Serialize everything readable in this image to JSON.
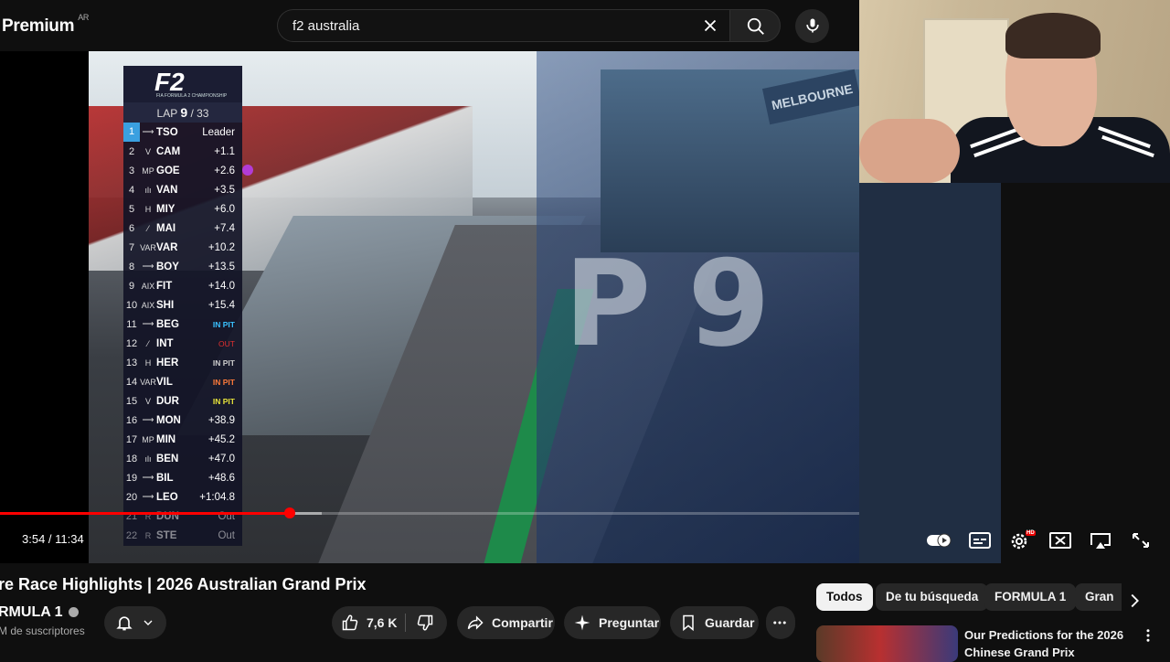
{
  "header": {
    "logo_text": "Premium",
    "logo_region": "AR",
    "search_value": "f2 australia"
  },
  "overlay": {
    "series": "F2",
    "series_sub": "FIA FORMULA 2 CHAMPIONSHIP",
    "lap_label": "LAP",
    "lap_current": "9",
    "lap_total": "/ 33",
    "big_text": "P9",
    "hoarding_text": "MELBOURNE"
  },
  "standings": [
    {
      "pos": "1",
      "team": "⟶",
      "code": "TSO",
      "gap": "Leader",
      "type": "leader"
    },
    {
      "pos": "2",
      "team": "V",
      "code": "CAM",
      "gap": "+1.1",
      "type": "normal"
    },
    {
      "pos": "3",
      "team": "MP",
      "code": "GOE",
      "gap": "+2.6",
      "type": "normal"
    },
    {
      "pos": "4",
      "team": "ılı",
      "code": "VAN",
      "gap": "+3.5",
      "type": "normal"
    },
    {
      "pos": "5",
      "team": "H",
      "code": "MIY",
      "gap": "+6.0",
      "type": "normal"
    },
    {
      "pos": "6",
      "team": "⁄",
      "code": "MAI",
      "gap": "+7.4",
      "type": "normal"
    },
    {
      "pos": "7",
      "team": "VAR",
      "code": "VAR",
      "gap": "+10.2",
      "type": "normal"
    },
    {
      "pos": "8",
      "team": "⟶",
      "code": "BOY",
      "gap": "+13.5",
      "type": "normal"
    },
    {
      "pos": "9",
      "team": "AIX",
      "code": "FIT",
      "gap": "+14.0",
      "type": "normal"
    },
    {
      "pos": "10",
      "team": "AIX",
      "code": "SHI",
      "gap": "+15.4",
      "type": "normal"
    },
    {
      "pos": "11",
      "team": "⟶",
      "code": "BEG",
      "gap": "IN PIT",
      "type": "inpit"
    },
    {
      "pos": "12",
      "team": "⁄",
      "code": "INT",
      "gap": "OUT",
      "type": "red"
    },
    {
      "pos": "13",
      "team": "H",
      "code": "HER",
      "gap": "IN PIT",
      "type": "inpit-white"
    },
    {
      "pos": "14",
      "team": "VAR",
      "code": "VIL",
      "gap": "IN PIT",
      "type": "inpit-orange"
    },
    {
      "pos": "15",
      "team": "V",
      "code": "DUR",
      "gap": "IN PIT",
      "type": "inpit-yellow"
    },
    {
      "pos": "16",
      "team": "⟶",
      "code": "MON",
      "gap": "+38.9",
      "type": "normal"
    },
    {
      "pos": "17",
      "team": "MP",
      "code": "MIN",
      "gap": "+45.2",
      "type": "normal"
    },
    {
      "pos": "18",
      "team": "ılı",
      "code": "BEN",
      "gap": "+47.0",
      "type": "normal"
    },
    {
      "pos": "19",
      "team": "⟶",
      "code": "BIL",
      "gap": "+48.6",
      "type": "normal"
    },
    {
      "pos": "20",
      "team": "⟶",
      "code": "LEO",
      "gap": "+1:04.8",
      "type": "normal"
    },
    {
      "pos": "21",
      "team": "R",
      "code": "DUN",
      "gap": "Out",
      "type": "out"
    },
    {
      "pos": "22",
      "team": "R",
      "code": "STE",
      "gap": "Out",
      "type": "out"
    }
  ],
  "player": {
    "time_current": "3:54",
    "time_total": "11:34",
    "time_display": "3:54 / 11:34",
    "progress_fraction": 0.337,
    "buffered_fraction": 0.374,
    "hd_badge": "HD"
  },
  "video_info": {
    "title": "re Race Highlights | 2026 Australian Grand Prix",
    "channel": "RMULA 1",
    "subscribers": "M de suscriptores",
    "like_count": "7,6 K",
    "share_label": "Compartir",
    "ask_label": "Preguntar",
    "save_label": "Guardar"
  },
  "chips": {
    "all": "Todos",
    "search": "De tu búsqueda",
    "f1": "FORMULA 1",
    "gran": "Gran"
  },
  "recommendation": {
    "title": "Our Predictions for the 2026 Chinese Grand Prix"
  },
  "colors": {
    "accent": "#ff0000",
    "background": "#0f0f0f",
    "leader_blue": "#3aa0e0"
  }
}
